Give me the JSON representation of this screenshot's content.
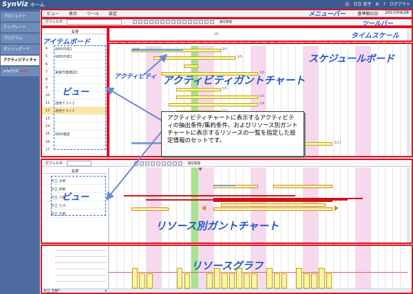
{
  "topbar": {
    "logo": "SynViz",
    "home": "ホーム",
    "user": "日立 花子",
    "user_icon": "person-icon",
    "logout": "ログアウト"
  },
  "sidebar": {
    "items": [
      {
        "label": "プロジェクト",
        "active": false
      },
      {
        "label": "テンプレート",
        "active": false
      },
      {
        "label": "プログラム",
        "active": false
      },
      {
        "label": "ダッシュボード",
        "active": false
      },
      {
        "label": "アクティビティチャート",
        "active": true
      },
      {
        "label": "お知らせ",
        "badge": "New!",
        "active": false
      }
    ]
  },
  "menubar": {
    "items": [
      "ビュー",
      "表示",
      "ツール",
      "設定"
    ],
    "base_date_label": "基準期日日",
    "base_date": "2017/04/28"
  },
  "toolbar": {
    "filter_label": "行フィルタ",
    "text": "通信管理"
  },
  "activity_board": {
    "column_header": "名称",
    "rows": [
      {
        "num": "4",
        "name": "WBS作成1"
      },
      {
        "num": "5",
        "name": "WBS作成2"
      },
      {
        "num": "6",
        "name": ""
      },
      {
        "num": "7",
        "name": "実装作業確認1"
      },
      {
        "num": "8",
        "name": ""
      },
      {
        "num": "9",
        "name": ""
      },
      {
        "num": "10",
        "name": ""
      },
      {
        "num": "11",
        "name": "運用テスト1"
      },
      {
        "num": "12",
        "name": "運用テスト1"
      },
      {
        "num": "13",
        "name": ""
      },
      {
        "num": "14",
        "name": ""
      },
      {
        "num": "15",
        "name": "WBS確認"
      },
      {
        "num": "16",
        "name": ""
      },
      {
        "num": "17",
        "name": ""
      }
    ]
  },
  "timescale": {
    "month_labels": [
      "05"
    ],
    "days": [
      "17",
      "18",
      "19",
      "20",
      "21",
      "22",
      "23",
      "24",
      "25",
      "26",
      "27",
      "28",
      "29",
      "30",
      "01",
      "02",
      "03",
      "04",
      "05",
      "06",
      "07",
      "08",
      "09",
      "10",
      "11",
      "12",
      "13",
      "14",
      "15",
      "16",
      "17",
      "18",
      "19",
      "20",
      "21",
      "22",
      "23",
      "24",
      "25",
      "26"
    ]
  },
  "gantt_labels": [
    "4/04",
    "5/5",
    "5/5",
    "5/5",
    "5/5",
    "5/5",
    "5/6",
    "5/5",
    "5/8",
    "5/6",
    "5/17"
  ],
  "resource_board": {
    "filter_label": "行フィルタ",
    "toolbar_text": "通信管理",
    "column_header": "名称",
    "rows": [
      {
        "name": "日立 太郎"
      },
      {
        "name": "日立 四郎"
      },
      {
        "name": "日立 六郎"
      },
      {
        "name": "日立 七子"
      },
      {
        "name": "日立 五郎"
      }
    ]
  },
  "graph_footer": {
    "resource": "日立 五郎*"
  },
  "annotations": {
    "menubar": "メニューバー",
    "toolbar": "ツールバー",
    "itemboard": "アイテムボード",
    "timescale": "タイムスケール",
    "scheduleboard": "スケジュールボード",
    "activity_view_label": "アクティビティ",
    "activity_gantt": "アクティビティガントチャート",
    "view1": "ビュー",
    "view2": "ビュー",
    "resource_gantt": "リソース別ガントチャート",
    "resource_graph": "リソースグラフ",
    "callout": "アクティビティチャートに表示するアクティビティの抽出条件/集約条件、およびリソース別ガントチャートに表示するリソースの一覧を指定した設定情報のセットです。"
  },
  "colors": {
    "topbar": "#3c5a8e",
    "sidebar": "#4d6b9e",
    "annotation_red": "#e0101e",
    "annotation_blue": "#1f56c8",
    "weekend_pink": "#f8d8ef",
    "today_green": "#a8e38e",
    "bar_yellow": "#fdf3a0",
    "bar_red": "#d01212"
  }
}
